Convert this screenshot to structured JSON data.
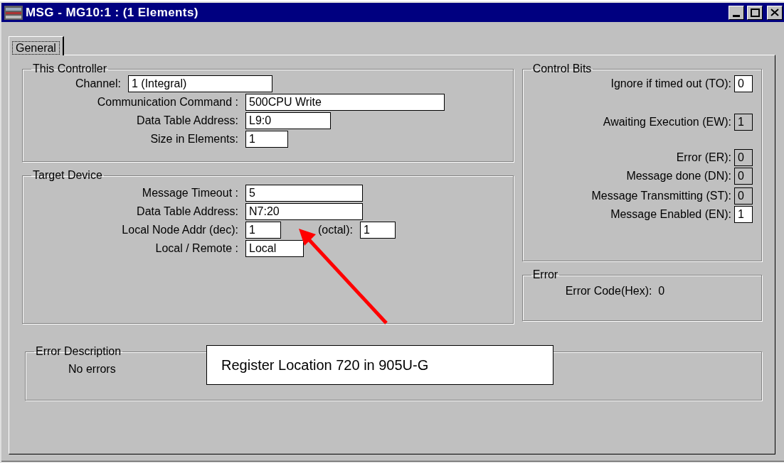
{
  "window": {
    "title": "MSG - MG10:1 : (1 Elements)"
  },
  "tabs": [
    {
      "label": "General",
      "selected": true
    }
  ],
  "this_controller": {
    "title": "This Controller",
    "fields": [
      {
        "label": "Channel:",
        "value": "1 (Integral)"
      },
      {
        "label": "Communication Command :",
        "value": "500CPU Write"
      },
      {
        "label": "Data Table Address:",
        "value": "L9:0"
      },
      {
        "label": "Size in Elements:",
        "value": "1"
      }
    ]
  },
  "target_device": {
    "title": "Target Device",
    "fields": [
      {
        "label": "Message Timeout :",
        "value": "5"
      },
      {
        "label": "Data Table Address:",
        "value": "N7:20"
      },
      {
        "label": "Local Node Addr (dec):",
        "value": "1",
        "extra_label": "(octal):",
        "extra_value": "1"
      },
      {
        "label": "Local / Remote :",
        "value": "Local"
      }
    ]
  },
  "control_bits": {
    "title": "Control Bits",
    "bits": [
      {
        "label": "Ignore if timed out (TO):",
        "value": "0",
        "readonly": false
      },
      {
        "label": "Awaiting Execution (EW):",
        "value": "1",
        "readonly": true
      },
      {
        "label": "Error (ER):",
        "value": "0",
        "readonly": true
      },
      {
        "label": "Message done (DN):",
        "value": "0",
        "readonly": true
      },
      {
        "label": "Message Transmitting (ST):",
        "value": "0",
        "readonly": true
      },
      {
        "label": "Message Enabled (EN):",
        "value": "1",
        "readonly": false
      }
    ]
  },
  "error": {
    "title": "Error",
    "text": "Error Code(Hex):  0"
  },
  "error_description": {
    "title": "Error Description",
    "text": "No errors"
  },
  "annotation": {
    "text": "Register Location 720 in 905U-G"
  }
}
